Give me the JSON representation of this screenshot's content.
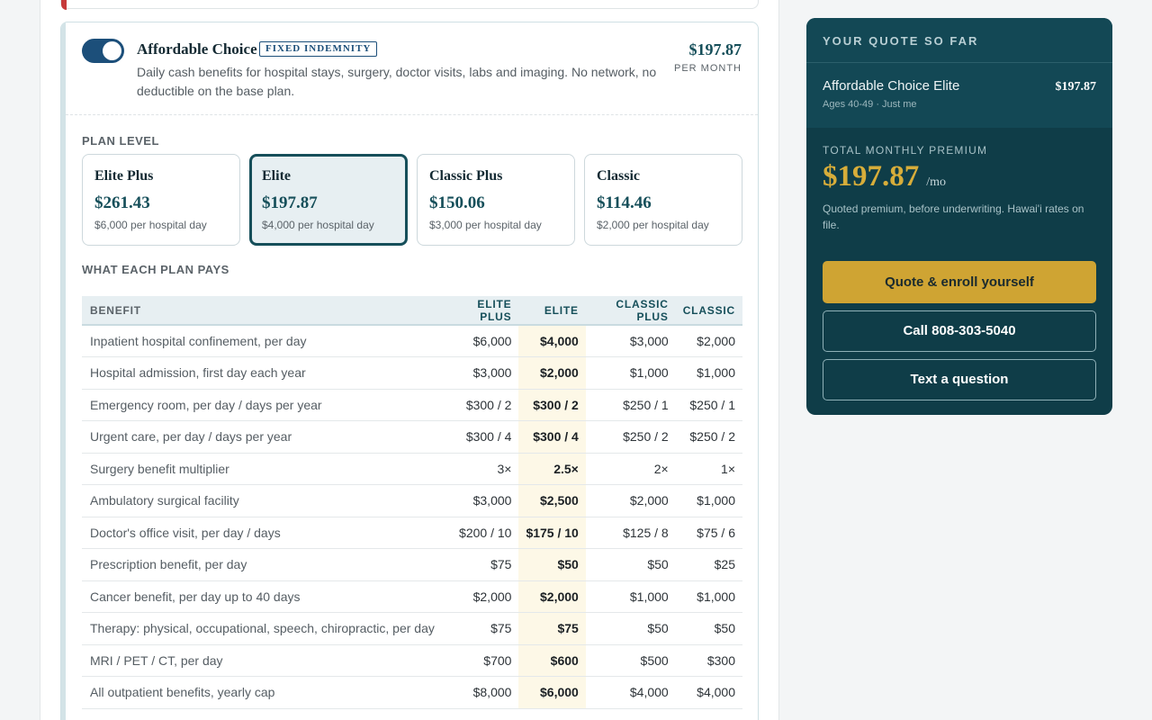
{
  "plan": {
    "name": "Affordable Choice",
    "badge": "FIXED INDEMNITY",
    "description": "Daily cash benefits for hospital stays, surgery, doctor visits, labs and imaging. No network, no deductible on the base plan.",
    "price": "$197.87",
    "price_unit": "PER MONTH",
    "enabled": true
  },
  "plan_level": {
    "label": "PLAN LEVEL",
    "selected": "Elite",
    "options": [
      {
        "name": "Elite Plus",
        "price": "$261.43",
        "sub": "$6,000 per hospital day"
      },
      {
        "name": "Elite",
        "price": "$197.87",
        "sub": "$4,000 per hospital day"
      },
      {
        "name": "Classic Plus",
        "price": "$150.06",
        "sub": "$3,000 per hospital day"
      },
      {
        "name": "Classic",
        "price": "$114.46",
        "sub": "$2,000 per hospital day"
      }
    ]
  },
  "benefits_table": {
    "label": "WHAT EACH PLAN PAYS",
    "headers": [
      "BENEFIT",
      "ELITE PLUS",
      "ELITE",
      "CLASSIC PLUS",
      "CLASSIC"
    ],
    "rows": [
      [
        "Inpatient hospital confinement, per day",
        "$6,000",
        "$4,000",
        "$3,000",
        "$2,000"
      ],
      [
        "Hospital admission, first day each year",
        "$3,000",
        "$2,000",
        "$1,000",
        "$1,000"
      ],
      [
        "Emergency room, per day / days per year",
        "$300 / 2",
        "$300 / 2",
        "$250 / 1",
        "$250 / 1"
      ],
      [
        "Urgent care, per day / days per year",
        "$300 / 4",
        "$300 / 4",
        "$250 / 2",
        "$250 / 2"
      ],
      [
        "Surgery benefit multiplier",
        "3×",
        "2.5×",
        "2×",
        "1×"
      ],
      [
        "Ambulatory surgical facility",
        "$3,000",
        "$2,500",
        "$2,000",
        "$1,000"
      ],
      [
        "Doctor's office visit, per day / days",
        "$200 / 10",
        "$175 / 10",
        "$125 / 8",
        "$75 / 6"
      ],
      [
        "Prescription benefit, per day",
        "$75",
        "$50",
        "$50",
        "$25"
      ],
      [
        "Cancer benefit, per day up to 40 days",
        "$2,000",
        "$2,000",
        "$1,000",
        "$1,000"
      ],
      [
        "Therapy: physical, occupational, speech, chiropractic, per day",
        "$75",
        "$75",
        "$50",
        "$50"
      ],
      [
        "MRI / PET / CT, per day",
        "$700",
        "$600",
        "$500",
        "$300"
      ],
      [
        "All outpatient benefits, yearly cap",
        "$8,000",
        "$6,000",
        "$4,000",
        "$4,000"
      ]
    ]
  },
  "quote": {
    "heading": "YOUR QUOTE SO FAR",
    "item_name": "Affordable Choice Elite",
    "item_price": "$197.87",
    "item_meta": "Ages 40-49 · Just me",
    "total_label": "TOTAL MONTHLY PREMIUM",
    "total_amount": "$197.87",
    "total_unit": "/mo",
    "note": "Quoted premium, before underwriting. Hawai'i rates on file.",
    "enroll_label": "Quote & enroll yourself",
    "call_label": "Call 808-303-5040",
    "text_label": "Text a question"
  },
  "colors": {
    "accent": "#164f5a",
    "toggle": "#1c4f7a",
    "gold": "#cfa433",
    "sidebar": "#0f3d48",
    "elite_highlight": "#fdf8e7"
  }
}
